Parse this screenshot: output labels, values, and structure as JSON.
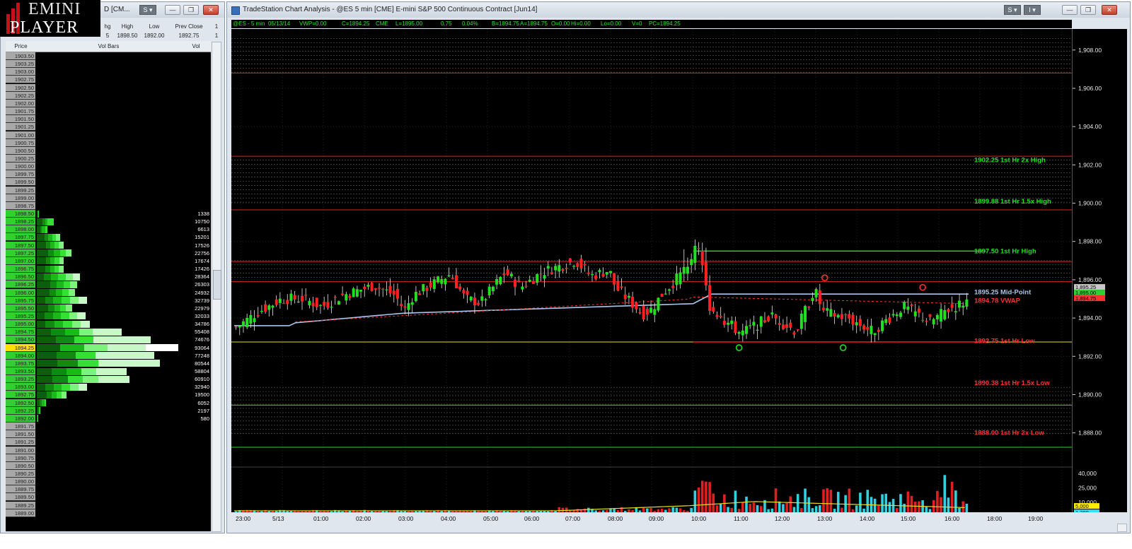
{
  "logo": {
    "line1": "EMINI",
    "line2": "PLAYER"
  },
  "matrix_window": {
    "title": "D [CM...",
    "s_button": "S",
    "headers": [
      "hg",
      "High",
      "Low",
      "Prev Close",
      "1"
    ],
    "values": [
      "5",
      "1898.50",
      "1892.00",
      "1892.75",
      "1"
    ],
    "ladder_headers": [
      "Price",
      "Vol Bars",
      "Vol"
    ],
    "ladder": [
      {
        "p": "1903.50",
        "v": ""
      },
      {
        "p": "1903.25",
        "v": ""
      },
      {
        "p": "1903.00",
        "v": ""
      },
      {
        "p": "1902.75",
        "v": ""
      },
      {
        "p": "1902.50",
        "v": ""
      },
      {
        "p": "1902.25",
        "v": ""
      },
      {
        "p": "1902.00",
        "v": ""
      },
      {
        "p": "1901.75",
        "v": ""
      },
      {
        "p": "1901.50",
        "v": ""
      },
      {
        "p": "1901.25",
        "v": ""
      },
      {
        "p": "1901.00",
        "v": ""
      },
      {
        "p": "1900.75",
        "v": ""
      },
      {
        "p": "1900.50",
        "v": ""
      },
      {
        "p": "1900.25",
        "v": ""
      },
      {
        "p": "1900.00",
        "v": ""
      },
      {
        "p": "1899.75",
        "v": ""
      },
      {
        "p": "1899.50",
        "v": ""
      },
      {
        "p": "1899.25",
        "v": ""
      },
      {
        "p": "1899.00",
        "v": ""
      },
      {
        "p": "1898.75",
        "v": ""
      },
      {
        "p": "1898.50",
        "v": "1338"
      },
      {
        "p": "1898.25",
        "v": "10750"
      },
      {
        "p": "1898.00",
        "v": "6613"
      },
      {
        "p": "1897.75",
        "v": "15201"
      },
      {
        "p": "1897.50",
        "v": "17526"
      },
      {
        "p": "1897.25",
        "v": "22756"
      },
      {
        "p": "1897.00",
        "v": "17674"
      },
      {
        "p": "1896.75",
        "v": "17426"
      },
      {
        "p": "1896.50",
        "v": "28364"
      },
      {
        "p": "1896.25",
        "v": "26303"
      },
      {
        "p": "1896.00",
        "v": "24932"
      },
      {
        "p": "1895.75",
        "v": "32739"
      },
      {
        "p": "1895.50",
        "v": "22979"
      },
      {
        "p": "1895.25",
        "v": "32033"
      },
      {
        "p": "1895.00",
        "v": "34786"
      },
      {
        "p": "1894.75",
        "v": "55408"
      },
      {
        "p": "1894.50",
        "v": "74676"
      },
      {
        "p": "1894.25",
        "v": "93064"
      },
      {
        "p": "1894.00",
        "v": "77248"
      },
      {
        "p": "1893.75",
        "v": "80544"
      },
      {
        "p": "1893.50",
        "v": "58804"
      },
      {
        "p": "1893.25",
        "v": "60910"
      },
      {
        "p": "1893.00",
        "v": "32940"
      },
      {
        "p": "1892.75",
        "v": "19500"
      },
      {
        "p": "1892.50",
        "v": "6052"
      },
      {
        "p": "1892.25",
        "v": "2197"
      },
      {
        "p": "1892.00",
        "v": "580"
      },
      {
        "p": "1891.75",
        "v": ""
      },
      {
        "p": "1891.50",
        "v": ""
      },
      {
        "p": "1891.25",
        "v": ""
      },
      {
        "p": "1891.00",
        "v": ""
      },
      {
        "p": "1890.75",
        "v": ""
      },
      {
        "p": "1890.50",
        "v": ""
      },
      {
        "p": "1890.25",
        "v": ""
      },
      {
        "p": "1890.00",
        "v": ""
      },
      {
        "p": "1889.75",
        "v": ""
      },
      {
        "p": "1889.50",
        "v": ""
      },
      {
        "p": "1889.25",
        "v": ""
      },
      {
        "p": "1889.00",
        "v": ""
      }
    ],
    "last_price": "1894.25",
    "colors": {
      "last_highlight": "#ffe000",
      "traded_price_bg": "#2fd02f",
      "untraded_price_bg": "#a8a8a8"
    }
  },
  "chart_window": {
    "title": "TradeStation Chart Analysis - @ES 5 min [CME] E-mini S&P 500 Continuous Contract [Jun14]",
    "s_button": "S",
    "i_button": "I",
    "info_items": [
      "@ES - 5 min",
      "05/13/14",
      "VWP=0.00",
      "C=1894.25",
      "CME",
      "L=1895.00",
      "0.75",
      "0.04%",
      "B=1894.75",
      "A=1894.75",
      "O=0.00",
      "Hi=0.00",
      "Lo=0.00",
      "V=0",
      "PC=1894.25"
    ]
  },
  "chart_data": [
    {
      "type": "candlestick",
      "title": "TradeStation Chart Analysis - @ES 5 min [CME] E-mini S&P 500 Continuous Contract [Jun14]",
      "x_ticks": [
        "23:00",
        "5/13",
        "01:00",
        "02:00",
        "03:00",
        "04:00",
        "05:00",
        "06:00",
        "07:00",
        "08:00",
        "09:00",
        "10:00",
        "11:00",
        "12:00",
        "13:00",
        "14:00",
        "15:00",
        "16:00",
        "18:00",
        "19:00"
      ],
      "y_ticks": [
        "1,908.00",
        "1,906.00",
        "1,904.00",
        "1,902.00",
        "1,900.00",
        "1,898.00",
        "1,896.00",
        "1,894.00",
        "1,892.00",
        "1,890.00",
        "1,888.00"
      ],
      "ylim": [
        1886.4,
        1909.1
      ],
      "close_path": [
        [
          0,
          1893.5
        ],
        [
          14,
          1894.3
        ],
        [
          30,
          1895.0
        ],
        [
          44,
          1895.0
        ],
        [
          56,
          1894.6
        ],
        [
          70,
          1895.2
        ],
        [
          90,
          1895.7
        ],
        [
          104,
          1895.2
        ],
        [
          110,
          1894.4
        ],
        [
          116,
          1895.2
        ],
        [
          140,
          1896.3
        ],
        [
          150,
          1895.0
        ],
        [
          160,
          1894.8
        ],
        [
          176,
          1896.4
        ],
        [
          186,
          1895.6
        ],
        [
          200,
          1896.4
        ],
        [
          222,
          1897.0
        ],
        [
          232,
          1896.2
        ],
        [
          244,
          1896.5
        ],
        [
          248,
          1895.6
        ],
        [
          256,
          1895.0
        ],
        [
          266,
          1894.2
        ],
        [
          272,
          1894.5
        ],
        [
          278,
          1895.2
        ],
        [
          292,
          1896.4
        ],
        [
          300,
          1897.5
        ],
        [
          304,
          1897.2
        ],
        [
          306,
          1896.0
        ],
        [
          310,
          1894.5
        ],
        [
          330,
          1893.2
        ],
        [
          350,
          1894.1
        ],
        [
          366,
          1893.3
        ],
        [
          378,
          1895.5
        ],
        [
          384,
          1894.3
        ],
        [
          400,
          1894.0
        ],
        [
          416,
          1893.3
        ],
        [
          436,
          1894.6
        ],
        [
          454,
          1893.8
        ],
        [
          464,
          1894.4
        ],
        [
          470,
          1894.6
        ],
        [
          480,
          1895.0
        ]
      ],
      "x_range": [
        0,
        480
      ],
      "levels": [
        {
          "label": "1902.25 1st Hr  2x High",
          "value": 1902.25,
          "color": "#22e022",
          "line_color": "#e02020",
          "label_y": 1902.25
        },
        {
          "label": "1899.88 1st Hr  1.5x High",
          "value": 1899.88,
          "color": "#22e022",
          "line_color": "#e02020",
          "label_y": 1900.1
        },
        {
          "label": "1897.50 1st Hr  High",
          "value": 1897.5,
          "color": "#22e022",
          "line_color": "#22e022",
          "label_y": 1897.5,
          "segment": true
        },
        {
          "label": "1895.25 Mid-Point",
          "value": 1895.25,
          "color": "#a9c7ef",
          "line_color": "#a9c7ef",
          "label_y": 1895.35
        },
        {
          "label": "1894.78 VWAP",
          "value": 1894.78,
          "color": "#ff3030",
          "line_color": "#ff3030",
          "label_y": 1894.9
        },
        {
          "label": "1892.75 1st Hr  Low",
          "value": 1892.75,
          "color": "#ff3030",
          "line_color": "#ff3030",
          "label_y": 1892.8
        },
        {
          "label": "1890.38 1st Hr  1.5x Low",
          "value": 1890.38,
          "color": "#ff3030",
          "line_color": "#22e022",
          "label_y": 1890.6
        },
        {
          "label": "1888.00 1st Hr  2x Low",
          "value": 1888.0,
          "color": "#ff3030",
          "line_color": "#22e022",
          "label_y": 1888.0
        }
      ],
      "y_last_labels": [
        {
          "text": "1,895.25",
          "bg": "#c8c8c8"
        },
        {
          "text": "1,895.00",
          "bg": "#30d030"
        },
        {
          "text": "1,894.75",
          "bg": "#ff3030"
        }
      ]
    },
    {
      "type": "bar",
      "title": "Volume",
      "y_ticks": [
        "40,000",
        "25,000",
        "10,000"
      ],
      "y_last_labels": [
        {
          "text": "5,000",
          "bg": "#ffee00"
        },
        {
          "text": "1,389",
          "bg": "#30e0ff"
        }
      ],
      "ylim": [
        0,
        45000
      ]
    }
  ]
}
